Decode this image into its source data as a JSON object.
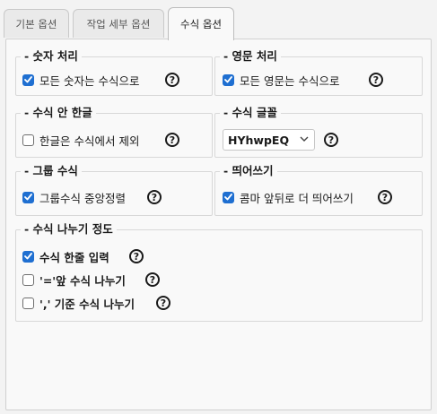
{
  "tabs": [
    {
      "label": "기본 옵션",
      "active": false
    },
    {
      "label": "작업 세부 옵션",
      "active": false
    },
    {
      "label": "수식 옵션",
      "active": true
    }
  ],
  "groups": {
    "number": {
      "title": "- 숫자 처리",
      "option": {
        "label": "모든 숫자는 수식으로",
        "checked": true
      }
    },
    "english": {
      "title": "- 영문 처리",
      "option": {
        "label": "모든 영문는 수식으로",
        "checked": true
      }
    },
    "hangul": {
      "title": "- 수식 안 한글",
      "option": {
        "label": "한글은 수식에서 제외",
        "checked": false
      }
    },
    "font": {
      "title": "- 수식 글꼴",
      "selected": "HYhwpEQ"
    },
    "group_formula": {
      "title": "- 그룹 수식",
      "option": {
        "label": "그룹수식 중앙정렬",
        "checked": true
      }
    },
    "spacing": {
      "title": "- 띄어쓰기",
      "option": {
        "label": "콤마 앞뒤로 더 띄어쓰기",
        "checked": true
      }
    },
    "split": {
      "title": "- 수식 나누기 정도",
      "options": [
        {
          "label": "수식 한줄 입력",
          "checked": true
        },
        {
          "label": "'='앞 수식 나누기",
          "checked": false
        },
        {
          "label": "',' 기준 수식 나누기",
          "checked": false
        }
      ]
    }
  },
  "help_glyph": "?",
  "colors": {
    "accent": "#1f6fd1"
  }
}
